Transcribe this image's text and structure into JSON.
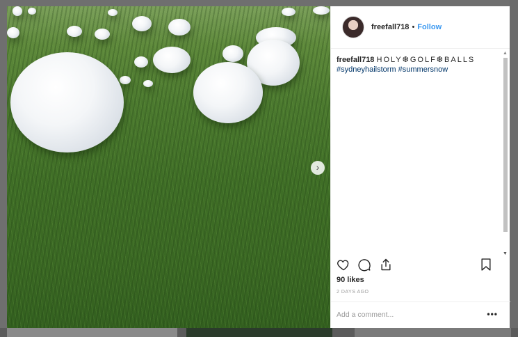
{
  "post": {
    "username": "freefall718",
    "separator": "•",
    "follow_label": "Follow",
    "caption_user": "freefall718",
    "caption_text": "HOLY❆GOLF❆BALLS",
    "hashtags": "#sydneyhailstorm #summersnow",
    "likes": "90 likes",
    "time_ago": "2 DAYS AGO"
  },
  "comment": {
    "placeholder": "Add a comment...",
    "more_label": "•••"
  },
  "photo": {
    "next_arrow": "›"
  },
  "icons": {
    "like": "heart-icon",
    "comment": "comment-icon",
    "share": "share-icon",
    "save": "bookmark-icon"
  },
  "colors": {
    "follow": "#3897f0",
    "hashtags": "#003569",
    "text": "#262626"
  }
}
